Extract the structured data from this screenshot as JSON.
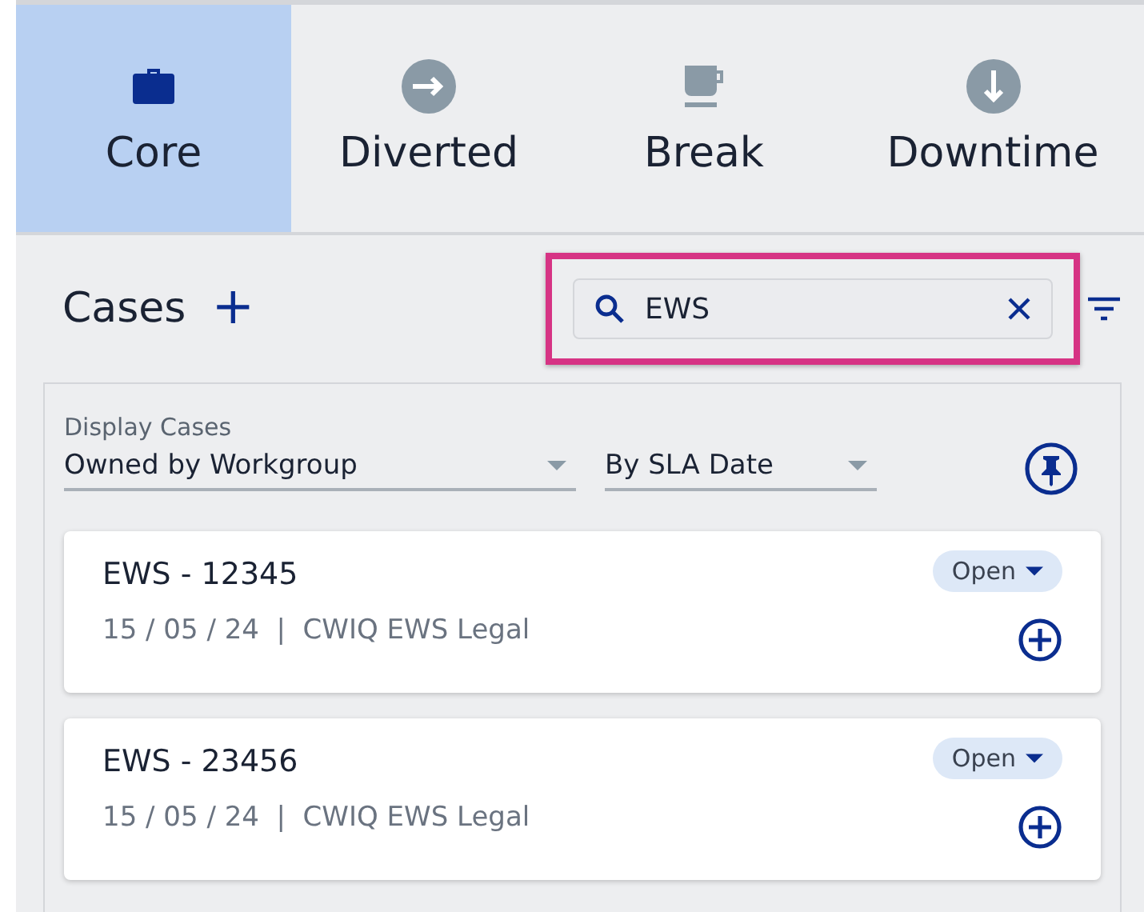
{
  "tabs": [
    {
      "label": "Core",
      "kind": "briefcase",
      "selected": true
    },
    {
      "label": "Diverted",
      "kind": "arrow-right",
      "selected": false
    },
    {
      "label": "Break",
      "kind": "cup",
      "selected": false
    },
    {
      "label": "Downtime",
      "kind": "arrow-down",
      "selected": false
    }
  ],
  "cases": {
    "title": "Cases",
    "add_icon": "+",
    "search": {
      "value": "EWS",
      "highlighted": true
    },
    "display_label": "Display Cases",
    "owner_filter": "Owned by Workgroup",
    "sort": "By SLA Date",
    "items": [
      {
        "id": "EWS - 12345",
        "meta": "15 / 05 / 24  |  CWIQ EWS Legal",
        "status": "Open"
      },
      {
        "id": "EWS - 23456",
        "meta": "15 / 05 / 24  |  CWIQ EWS Legal",
        "status": "Open"
      }
    ]
  }
}
